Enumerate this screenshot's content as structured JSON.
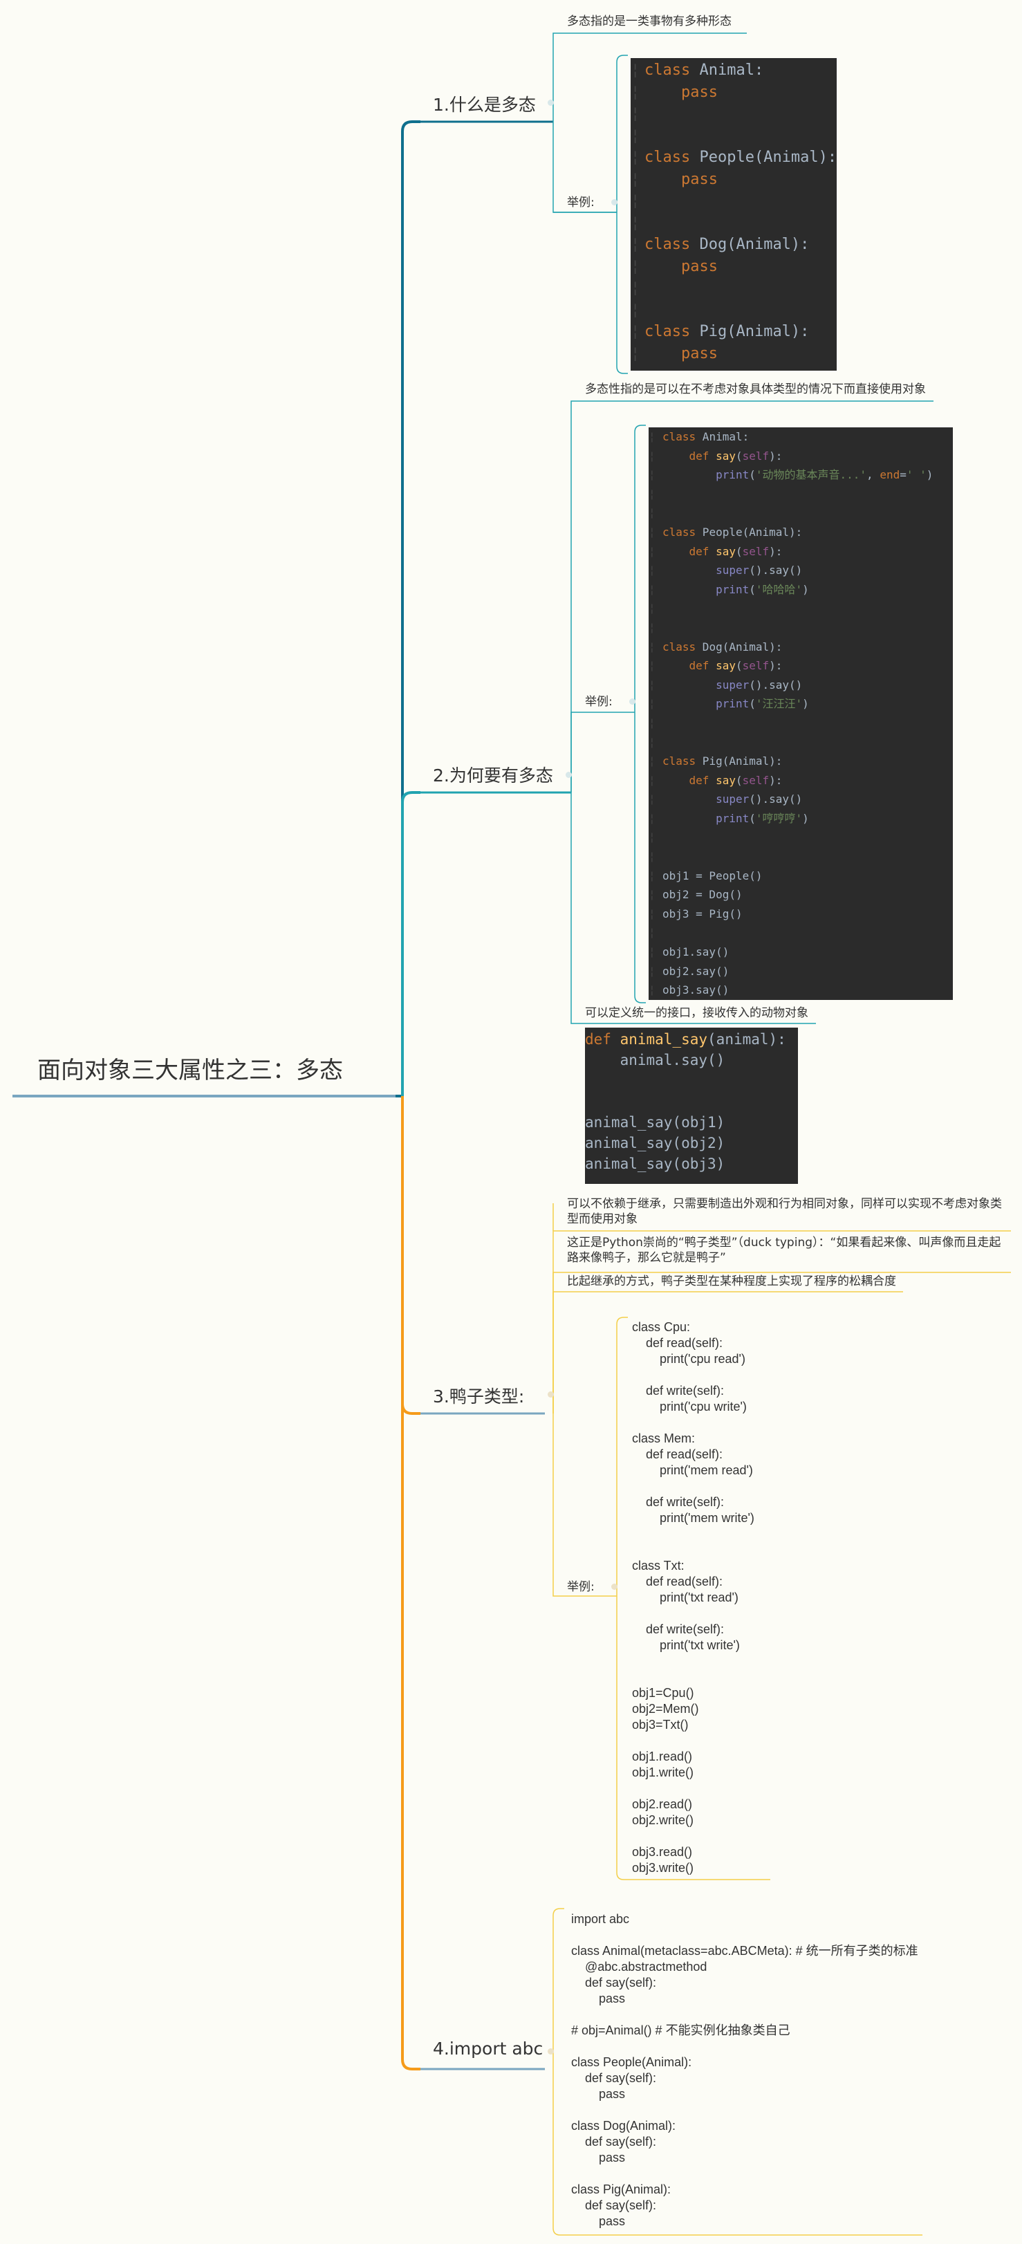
{
  "root": {
    "title": "面向对象三大属性之三：多态"
  },
  "branches": [
    {
      "title": "1.什么是多态",
      "items": [
        {
          "text": "多态指的是一类事物有多种形态"
        },
        {
          "label": "举例:",
          "code": "class Animal:\n    pass\n\n\nclass People(Animal):\n    pass\n\n\nclass Dog(Animal):\n    pass\n\n\nclass Pig(Animal):\n    pass"
        }
      ]
    },
    {
      "title": "2.为何要有多态",
      "items": [
        {
          "text": "多态性指的是可以在不考虑对象具体类型的情况下而直接使用对象"
        },
        {
          "label": "举例:",
          "code": "class Animal:\n    def say(self):\n        print('动物的基本声音...', end=' ')\n\n\nclass People(Animal):\n    def say(self):\n        super().say()\n        print('哈哈哈')\n\n\nclass Dog(Animal):\n    def say(self):\n        super().say()\n        print('汪汪汪')\n\n\nclass Pig(Animal):\n    def say(self):\n        super().say()\n        print('哼哼哼')\n\n\nobj1 = People()\nobj2 = Dog()\nobj3 = Pig()\n\nobj1.say()\nobj2.say()\nobj3.say()"
        },
        {
          "text": "可以定义统一的接口，接收传入的动物对象",
          "code": "def animal_say(animal):\n    animal.say()\n\n\nanimal_say(obj1)\nanimal_say(obj2)\nanimal_say(obj3)"
        }
      ]
    },
    {
      "title": "3.鸭子类型:",
      "items": [
        {
          "text": "可以不依赖于继承，只需要制造出外观和行为相同对象，同样可以实现不考虑对象类型而使用对象"
        },
        {
          "text": "这正是Python崇尚的“鸭子类型”（duck typing）：“如果看起来像、叫声像而且走起路来像鸭子，那么它就是鸭子”"
        },
        {
          "text": "比起继承的方式，鸭子类型在某种程度上实现了程序的松耦合度"
        },
        {
          "label": "举例:",
          "code": "class Cpu:\n    def read(self):\n        print('cpu read')\n\n    def write(self):\n        print('cpu write')\n\nclass Mem:\n    def read(self):\n        print('mem read')\n\n    def write(self):\n        print('mem write')\n\n\nclass Txt:\n    def read(self):\n        print('txt read')\n\n    def write(self):\n        print('txt write')\n\n\nobj1=Cpu()\nobj2=Mem()\nobj3=Txt()\n\nobj1.read()\nobj1.write()\n\nobj2.read()\nobj2.write()\n\nobj3.read()\nobj3.write()"
        }
      ]
    },
    {
      "title": "4.import abc",
      "items": [
        {
          "code": "import abc\n\nclass Animal(metaclass=abc.ABCMeta): # 统一所有子类的标准\n    @abc.abstractmethod\n    def say(self):\n        pass\n\n# obj=Animal() # 不能实例化抽象类自己\n\nclass People(Animal):\n    def say(self):\n        pass\n\nclass Dog(Animal):\n    def say(self):\n        pass\n\nclass Pig(Animal):\n    def say(self):\n        pass"
        }
      ]
    }
  ],
  "colors": {
    "teal": "#21a3b0",
    "blue": "#0f6f8d",
    "orange": "#f59b1a",
    "yellow": "#f3cf4a",
    "code_bg": "#2b2b2b"
  }
}
